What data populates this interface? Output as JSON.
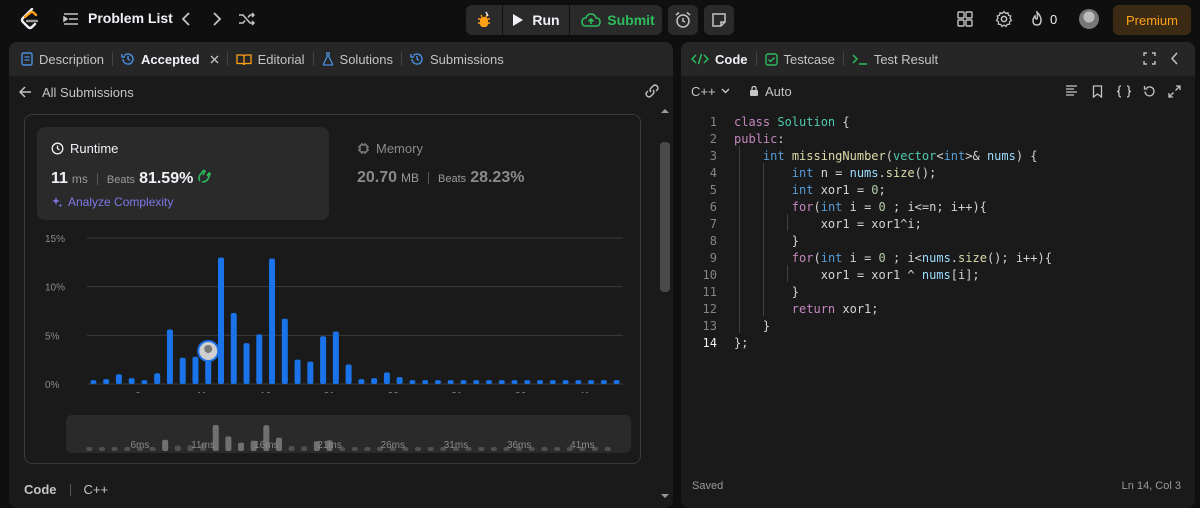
{
  "topbar": {
    "problem_list": "Problem List",
    "run": "Run",
    "submit": "Submit",
    "streak_count": "0",
    "premium": "Premium"
  },
  "left": {
    "tabs": [
      {
        "label": "Description",
        "icon": "description-icon"
      },
      {
        "label": "Accepted",
        "icon": "history-icon"
      },
      {
        "label": "Editorial",
        "icon": "book-icon"
      },
      {
        "label": "Solutions",
        "icon": "flask-icon"
      },
      {
        "label": "Submissions",
        "icon": "history-icon"
      }
    ],
    "back_label": "All Submissions",
    "runtime": {
      "title": "Runtime",
      "value": "11",
      "unit": "ms",
      "beats_label": "Beats",
      "beats": "81.59%",
      "analyze": "Analyze Complexity"
    },
    "memory": {
      "title": "Memory",
      "value": "20.70",
      "unit": "MB",
      "beats_label": "Beats",
      "beats": "28.23%"
    },
    "footer": {
      "code_label": "Code",
      "lang": "C++"
    }
  },
  "chart_data": {
    "type": "bar",
    "x": [
      2,
      3,
      4,
      5,
      6,
      7,
      8,
      9,
      10,
      11,
      12,
      13,
      14,
      15,
      16,
      17,
      18,
      19,
      20,
      21,
      22,
      23,
      24,
      25,
      26,
      27,
      28,
      29,
      30,
      31,
      32,
      33,
      34,
      35,
      36,
      37,
      38,
      39,
      40,
      41,
      42,
      43
    ],
    "values": [
      0.4,
      0.5,
      1.0,
      0.6,
      0.4,
      1.1,
      5.6,
      2.7,
      2.8,
      3.6,
      13.0,
      7.3,
      4.2,
      5.1,
      12.9,
      6.7,
      2.5,
      2.3,
      4.9,
      5.4,
      2.0,
      0.5,
      0.6,
      1.2,
      0.7,
      0.4,
      0.4,
      0.4,
      0.4,
      0.4,
      0.4,
      0.4,
      0.4,
      0.4,
      0.4,
      0.4,
      0.4,
      0.4,
      0.4,
      0.4,
      0.4,
      0.4
    ],
    "highlight_x": 11,
    "xticks": [
      "6ms",
      "11ms",
      "16ms",
      "21ms",
      "26ms",
      "31ms",
      "36ms",
      "41ms"
    ],
    "xtick_values": [
      6,
      11,
      16,
      21,
      26,
      31,
      36,
      41
    ],
    "yticks": [
      "0%",
      "5%",
      "10%",
      "15%"
    ],
    "ylim": [
      0,
      15
    ],
    "grid": true,
    "colors": {
      "bar": "#1a73e8",
      "minimap_bar": "#505050",
      "minimap_bar_hi": "#707070"
    }
  },
  "editor": {
    "lang": "C++",
    "auto": "Auto",
    "tabs": [
      {
        "label": "Code",
        "icon": "code-icon"
      },
      {
        "label": "Testcase",
        "icon": "checkbox-icon"
      },
      {
        "label": "Test Result",
        "icon": "terminal-icon"
      }
    ],
    "lines": [
      "class Solution {",
      "public:",
      "    int missingNumber(vector<int>& nums) {",
      "        int n = nums.size();",
      "        int xor1 = 0;",
      "        for(int i = 0 ; i<=n; i++){",
      "            xor1 = xor1^i;",
      "        }",
      "        for(int i = 0 ; i<nums.size(); i++){",
      "            xor1 = xor1 ^ nums[i];",
      "        }",
      "        return xor1;",
      "    }",
      "};"
    ],
    "current_line": 14,
    "saved": "Saved",
    "cursor": "Ln 14, Col 3"
  }
}
